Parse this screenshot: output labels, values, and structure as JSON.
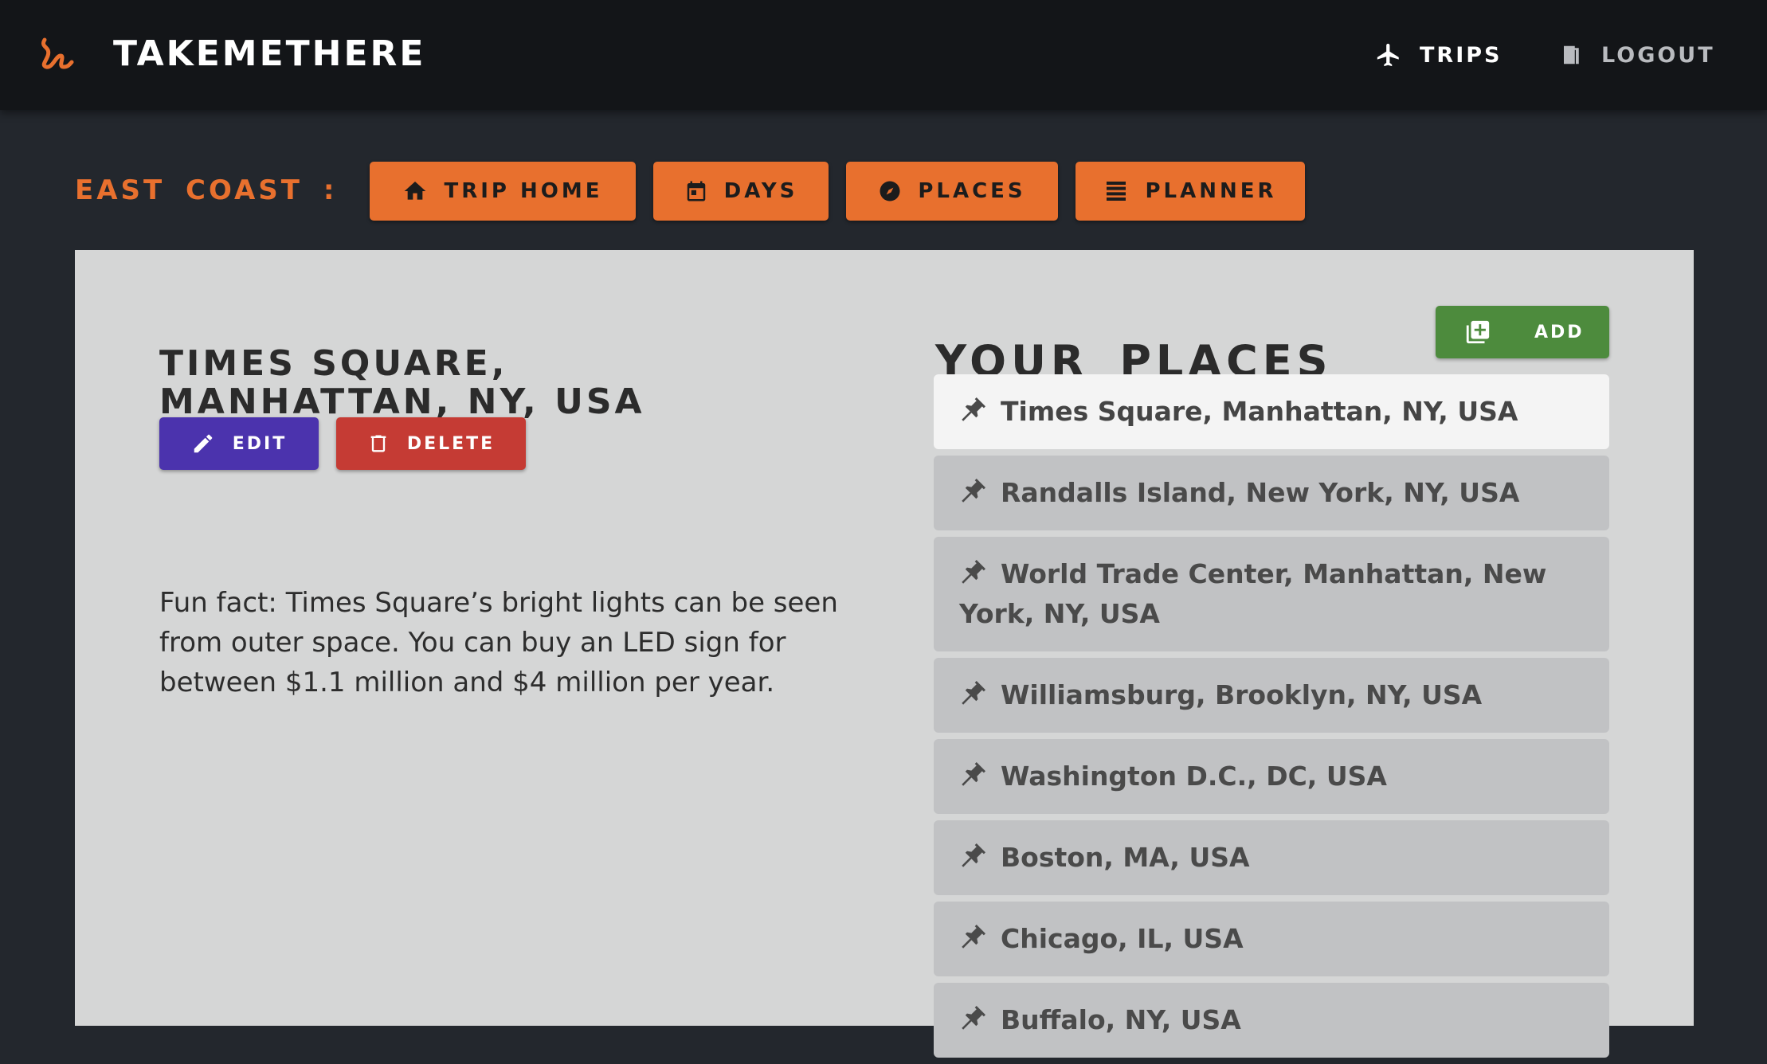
{
  "header": {
    "brand": "TAKEMETHERE",
    "nav": {
      "trips_label": "TRIPS",
      "logout_label": "LOGOUT"
    }
  },
  "trip": {
    "title": "EAST COAST :",
    "tabs": {
      "home": "TRIP HOME",
      "days": "DAYS",
      "places": "PLACES",
      "planner": "PLANNER"
    }
  },
  "place": {
    "title": "Times Square, Manhattan, NY, USA",
    "edit_label": "EDIT",
    "delete_label": "DELETE",
    "description": "Fun fact: Times Square’s bright lights can be seen from outer space. You can buy an LED sign for between $1.1 million and $4 million per year."
  },
  "places_panel": {
    "heading": "YOUR PLACES",
    "add_label": "ADD",
    "items": [
      "Times Square, Manhattan, NY, USA",
      "Randalls Island, New York, NY, USA",
      "World Trade Center, Manhattan, New York, NY, USA",
      "Williamsburg, Brooklyn, NY, USA",
      "Washington D.C., DC, USA",
      "Boston, MA, USA",
      "Chicago, IL, USA",
      "Buffalo, NY, USA"
    ]
  },
  "colors": {
    "accent": "#e8702e",
    "edit": "#4b33ad",
    "delete": "#c53b34",
    "add": "#4d8b3d",
    "page_bg": "#23272d",
    "panel_bg": "#d5d6d6"
  },
  "icons": {
    "brand": "squiggle-logo-icon",
    "trips": "airplane-icon",
    "logout": "door-icon",
    "home": "house-icon",
    "days": "calendar-icon",
    "places": "compass-icon",
    "planner": "list-icon",
    "edit": "pencil-icon",
    "delete": "trash-icon",
    "add": "add-box-icon",
    "place": "pushpin-icon"
  }
}
